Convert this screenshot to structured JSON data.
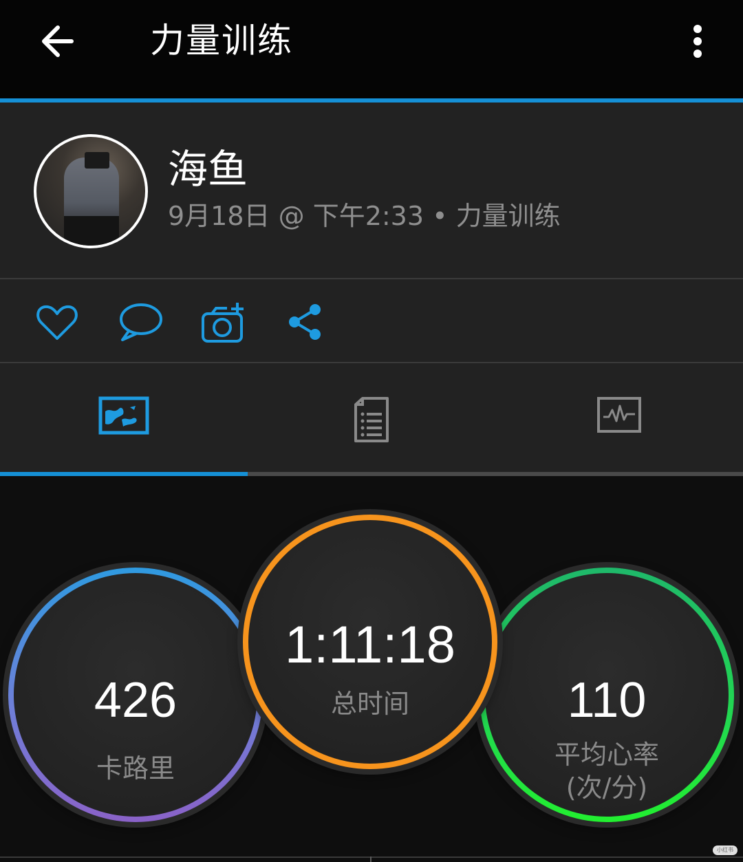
{
  "header": {
    "title": "力量训练"
  },
  "profile": {
    "name": "海鱼",
    "subtitle": "9月18日 @ 下午2:33 • 力量训练"
  },
  "stats": {
    "calories": {
      "value": "426",
      "label": "卡路里",
      "color": "#2f9ae0"
    },
    "total_time": {
      "value": "1:11:18",
      "label": "总时间",
      "color": "#f7941d"
    },
    "avg_hr": {
      "value": "110",
      "label_line1": "平均心率",
      "label_line2": "(次/分)",
      "color": "#22e23a"
    }
  },
  "colors": {
    "accent": "#1590d6",
    "icon_blue": "#1e9be0",
    "tab_inactive": "#8a8a8a"
  },
  "icons": [
    "back-arrow-icon",
    "more-vertical-icon",
    "heart-icon",
    "comment-icon",
    "add-photo-icon",
    "share-icon",
    "map-icon",
    "details-icon",
    "chart-icon"
  ],
  "tabs": {
    "active_index": 0
  },
  "watermark": "小红书"
}
